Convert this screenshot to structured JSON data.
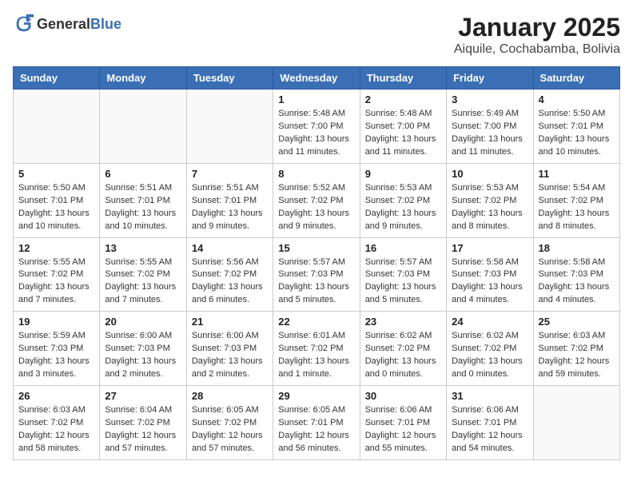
{
  "header": {
    "logo_general": "General",
    "logo_blue": "Blue",
    "month_title": "January 2025",
    "location": "Aiquile, Cochabamba, Bolivia"
  },
  "weekdays": [
    "Sunday",
    "Monday",
    "Tuesday",
    "Wednesday",
    "Thursday",
    "Friday",
    "Saturday"
  ],
  "weeks": [
    [
      {
        "day": "",
        "sunrise": "",
        "sunset": "",
        "daylight": ""
      },
      {
        "day": "",
        "sunrise": "",
        "sunset": "",
        "daylight": ""
      },
      {
        "day": "",
        "sunrise": "",
        "sunset": "",
        "daylight": ""
      },
      {
        "day": "1",
        "sunrise": "Sunrise: 5:48 AM",
        "sunset": "Sunset: 7:00 PM",
        "daylight": "Daylight: 13 hours and 11 minutes."
      },
      {
        "day": "2",
        "sunrise": "Sunrise: 5:48 AM",
        "sunset": "Sunset: 7:00 PM",
        "daylight": "Daylight: 13 hours and 11 minutes."
      },
      {
        "day": "3",
        "sunrise": "Sunrise: 5:49 AM",
        "sunset": "Sunset: 7:00 PM",
        "daylight": "Daylight: 13 hours and 11 minutes."
      },
      {
        "day": "4",
        "sunrise": "Sunrise: 5:50 AM",
        "sunset": "Sunset: 7:01 PM",
        "daylight": "Daylight: 13 hours and 10 minutes."
      }
    ],
    [
      {
        "day": "5",
        "sunrise": "Sunrise: 5:50 AM",
        "sunset": "Sunset: 7:01 PM",
        "daylight": "Daylight: 13 hours and 10 minutes."
      },
      {
        "day": "6",
        "sunrise": "Sunrise: 5:51 AM",
        "sunset": "Sunset: 7:01 PM",
        "daylight": "Daylight: 13 hours and 10 minutes."
      },
      {
        "day": "7",
        "sunrise": "Sunrise: 5:51 AM",
        "sunset": "Sunset: 7:01 PM",
        "daylight": "Daylight: 13 hours and 9 minutes."
      },
      {
        "day": "8",
        "sunrise": "Sunrise: 5:52 AM",
        "sunset": "Sunset: 7:02 PM",
        "daylight": "Daylight: 13 hours and 9 minutes."
      },
      {
        "day": "9",
        "sunrise": "Sunrise: 5:53 AM",
        "sunset": "Sunset: 7:02 PM",
        "daylight": "Daylight: 13 hours and 9 minutes."
      },
      {
        "day": "10",
        "sunrise": "Sunrise: 5:53 AM",
        "sunset": "Sunset: 7:02 PM",
        "daylight": "Daylight: 13 hours and 8 minutes."
      },
      {
        "day": "11",
        "sunrise": "Sunrise: 5:54 AM",
        "sunset": "Sunset: 7:02 PM",
        "daylight": "Daylight: 13 hours and 8 minutes."
      }
    ],
    [
      {
        "day": "12",
        "sunrise": "Sunrise: 5:55 AM",
        "sunset": "Sunset: 7:02 PM",
        "daylight": "Daylight: 13 hours and 7 minutes."
      },
      {
        "day": "13",
        "sunrise": "Sunrise: 5:55 AM",
        "sunset": "Sunset: 7:02 PM",
        "daylight": "Daylight: 13 hours and 7 minutes."
      },
      {
        "day": "14",
        "sunrise": "Sunrise: 5:56 AM",
        "sunset": "Sunset: 7:02 PM",
        "daylight": "Daylight: 13 hours and 6 minutes."
      },
      {
        "day": "15",
        "sunrise": "Sunrise: 5:57 AM",
        "sunset": "Sunset: 7:03 PM",
        "daylight": "Daylight: 13 hours and 5 minutes."
      },
      {
        "day": "16",
        "sunrise": "Sunrise: 5:57 AM",
        "sunset": "Sunset: 7:03 PM",
        "daylight": "Daylight: 13 hours and 5 minutes."
      },
      {
        "day": "17",
        "sunrise": "Sunrise: 5:58 AM",
        "sunset": "Sunset: 7:03 PM",
        "daylight": "Daylight: 13 hours and 4 minutes."
      },
      {
        "day": "18",
        "sunrise": "Sunrise: 5:58 AM",
        "sunset": "Sunset: 7:03 PM",
        "daylight": "Daylight: 13 hours and 4 minutes."
      }
    ],
    [
      {
        "day": "19",
        "sunrise": "Sunrise: 5:59 AM",
        "sunset": "Sunset: 7:03 PM",
        "daylight": "Daylight: 13 hours and 3 minutes."
      },
      {
        "day": "20",
        "sunrise": "Sunrise: 6:00 AM",
        "sunset": "Sunset: 7:03 PM",
        "daylight": "Daylight: 13 hours and 2 minutes."
      },
      {
        "day": "21",
        "sunrise": "Sunrise: 6:00 AM",
        "sunset": "Sunset: 7:03 PM",
        "daylight": "Daylight: 13 hours and 2 minutes."
      },
      {
        "day": "22",
        "sunrise": "Sunrise: 6:01 AM",
        "sunset": "Sunset: 7:02 PM",
        "daylight": "Daylight: 13 hours and 1 minute."
      },
      {
        "day": "23",
        "sunrise": "Sunrise: 6:02 AM",
        "sunset": "Sunset: 7:02 PM",
        "daylight": "Daylight: 13 hours and 0 minutes."
      },
      {
        "day": "24",
        "sunrise": "Sunrise: 6:02 AM",
        "sunset": "Sunset: 7:02 PM",
        "daylight": "Daylight: 13 hours and 0 minutes."
      },
      {
        "day": "25",
        "sunrise": "Sunrise: 6:03 AM",
        "sunset": "Sunset: 7:02 PM",
        "daylight": "Daylight: 12 hours and 59 minutes."
      }
    ],
    [
      {
        "day": "26",
        "sunrise": "Sunrise: 6:03 AM",
        "sunset": "Sunset: 7:02 PM",
        "daylight": "Daylight: 12 hours and 58 minutes."
      },
      {
        "day": "27",
        "sunrise": "Sunrise: 6:04 AM",
        "sunset": "Sunset: 7:02 PM",
        "daylight": "Daylight: 12 hours and 57 minutes."
      },
      {
        "day": "28",
        "sunrise": "Sunrise: 6:05 AM",
        "sunset": "Sunset: 7:02 PM",
        "daylight": "Daylight: 12 hours and 57 minutes."
      },
      {
        "day": "29",
        "sunrise": "Sunrise: 6:05 AM",
        "sunset": "Sunset: 7:01 PM",
        "daylight": "Daylight: 12 hours and 56 minutes."
      },
      {
        "day": "30",
        "sunrise": "Sunrise: 6:06 AM",
        "sunset": "Sunset: 7:01 PM",
        "daylight": "Daylight: 12 hours and 55 minutes."
      },
      {
        "day": "31",
        "sunrise": "Sunrise: 6:06 AM",
        "sunset": "Sunset: 7:01 PM",
        "daylight": "Daylight: 12 hours and 54 minutes."
      },
      {
        "day": "",
        "sunrise": "",
        "sunset": "",
        "daylight": ""
      }
    ]
  ]
}
